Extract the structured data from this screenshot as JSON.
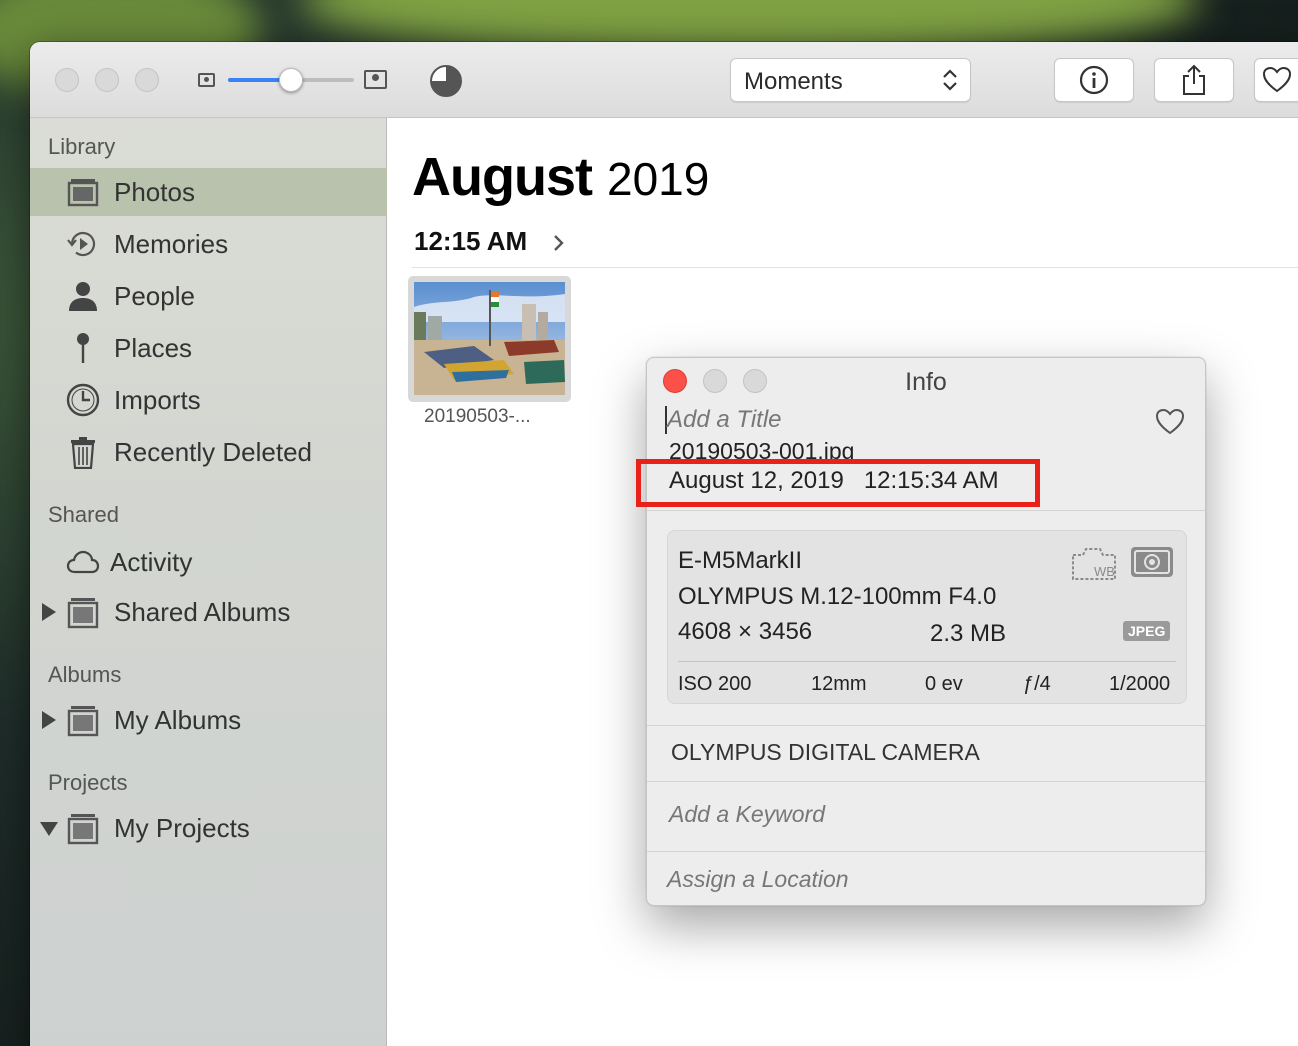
{
  "toolbar": {
    "view_select": "Moments",
    "zoom_level": 0.5
  },
  "sidebar": {
    "sections": [
      {
        "heading": "Library"
      },
      {
        "heading": "Shared"
      },
      {
        "heading": "Albums"
      },
      {
        "heading": "Projects"
      }
    ],
    "items": [
      {
        "label": "Photos",
        "icon": "photos-icon",
        "selected": true
      },
      {
        "label": "Memories",
        "icon": "memories-icon"
      },
      {
        "label": "People",
        "icon": "person-icon"
      },
      {
        "label": "Places",
        "icon": "pin-icon"
      },
      {
        "label": "Imports",
        "icon": "clock-icon"
      },
      {
        "label": "Recently Deleted",
        "icon": "trash-icon"
      },
      {
        "label": "Activity",
        "icon": "cloud-icon"
      },
      {
        "label": "Shared Albums",
        "icon": "album-icon",
        "expanded": false
      },
      {
        "label": "My Albums",
        "icon": "album-icon",
        "expanded": false
      },
      {
        "label": "My Projects",
        "icon": "album-icon",
        "expanded": true
      }
    ]
  },
  "main": {
    "month": "August",
    "year": "2019",
    "moment_time": "12:15 AM",
    "photos": [
      {
        "caption": "20190503-..."
      }
    ]
  },
  "info_panel": {
    "title": "Info",
    "title_placeholder": "Add a Title",
    "filename": "20190503-001.jpg",
    "datetime": "August 12, 2019   12:15:34 AM",
    "camera": {
      "model": "E-M5MarkII",
      "lens": "OLYMPUS M.12-100mm F4.0",
      "dimensions": "4608 × 3456",
      "file_size": "2.3 MB",
      "format_badge": "JPEG",
      "iso": "ISO 200",
      "focal_length": "12mm",
      "exposure_bias": "0 ev",
      "aperture": "ƒ/4",
      "shutter": "1/2000"
    },
    "description": "OLYMPUS DIGITAL CAMERA",
    "keyword_placeholder": "Add a Keyword",
    "location_placeholder": "Assign a Location"
  },
  "colors": {
    "accent": "#3b82f6",
    "selection": "#b9c2ad",
    "highlight_box": "#e8211a",
    "close_button": "#fb5148"
  }
}
